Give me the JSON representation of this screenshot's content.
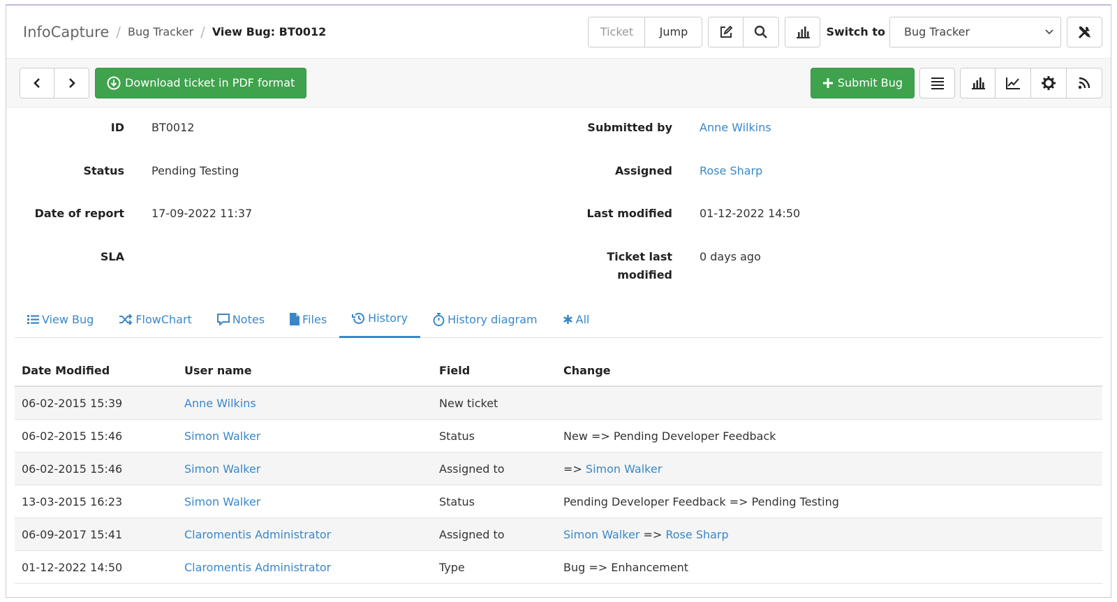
{
  "header": {
    "app_name": "InfoCapture",
    "breadcrumb_module": "Bug Tracker",
    "breadcrumb_current": "View Bug: BT0012",
    "ticket_placeholder": "Ticket",
    "jump_label": "Jump",
    "switch_label": "Switch to",
    "switch_value": "Bug Tracker"
  },
  "toolbar": {
    "download_label": "Download ticket in PDF format",
    "submit_label": "Submit Bug"
  },
  "details": {
    "id_label": "ID",
    "id_value": "BT0012",
    "status_label": "Status",
    "status_value": "Pending Testing",
    "date_label": "Date of report",
    "date_value": "17-09-2022 11:37",
    "sla_label": "SLA",
    "submitted_label": "Submitted by",
    "submitted_value": "Anne Wilkins",
    "assigned_label": "Assigned",
    "assigned_value": "Rose Sharp",
    "modified_label": "Last modified",
    "modified_value": "01-12-2022 14:50",
    "ticket_last_label_1": "Ticket last",
    "ticket_last_label_2": "modified",
    "ticket_last_value": "0 days ago"
  },
  "tabs": [
    {
      "label": "View Bug",
      "icon": "list-icon"
    },
    {
      "label": "FlowChart",
      "icon": "shuffle-icon"
    },
    {
      "label": "Notes",
      "icon": "comment-icon"
    },
    {
      "label": "Files",
      "icon": "file-icon"
    },
    {
      "label": "History",
      "icon": "history-icon",
      "active": true
    },
    {
      "label": "History diagram",
      "icon": "stopwatch-icon"
    },
    {
      "label": "All",
      "icon": "asterisk-icon"
    }
  ],
  "history": {
    "columns": [
      "Date Modified",
      "User name",
      "Field",
      "Change"
    ],
    "rows": [
      {
        "date": "06-02-2015 15:39",
        "user": "Anne Wilkins",
        "field": "New ticket",
        "change": ""
      },
      {
        "date": "06-02-2015 15:46",
        "user": "Simon Walker",
        "field": "Status",
        "change": "New => Pending Developer Feedback"
      },
      {
        "date": "06-02-2015 15:46",
        "user": "Simon Walker",
        "field": "Assigned to",
        "change_prefix": "=> ",
        "change_to": "Simon Walker"
      },
      {
        "date": "13-03-2015 16:23",
        "user": "Simon Walker",
        "field": "Status",
        "change": "Pending Developer Feedback => Pending Testing"
      },
      {
        "date": "06-09-2017 15:41",
        "user": "Claromentis Administrator",
        "field": "Assigned to",
        "change_from": "Simon Walker",
        "change_arrow": " => ",
        "change_to": "Rose Sharp"
      },
      {
        "date": "01-12-2022 14:50",
        "user": "Claromentis Administrator",
        "field": "Type",
        "change": "Bug => Enhancement"
      }
    ]
  },
  "colors": {
    "link": "#3a87c8",
    "green": "#3fa34d"
  }
}
